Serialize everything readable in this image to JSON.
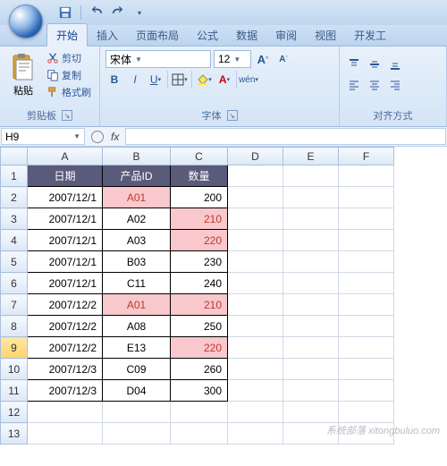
{
  "qat": {
    "save": "save",
    "undo": "undo",
    "redo": "redo"
  },
  "tabs": {
    "home": "开始",
    "insert": "插入",
    "layout": "页面布局",
    "formulas": "公式",
    "data": "数据",
    "review": "审阅",
    "view": "视图",
    "developer": "开发工"
  },
  "clipboard": {
    "paste": "粘贴",
    "cut": "剪切",
    "copy": "复制",
    "format_painter": "格式刷",
    "group": "剪贴板"
  },
  "font": {
    "name": "宋体",
    "size": "12",
    "grow": "A",
    "shrink": "A",
    "bold": "B",
    "italic": "I",
    "underline": "U",
    "group": "字体"
  },
  "align": {
    "group": "对齐方式"
  },
  "namebox": "H9",
  "fx": "fx",
  "columns": [
    "A",
    "B",
    "C",
    "D",
    "E",
    "F"
  ],
  "rows": [
    "1",
    "2",
    "3",
    "4",
    "5",
    "6",
    "7",
    "8",
    "9",
    "10",
    "11",
    "12",
    "13"
  ],
  "selected_row": "9",
  "headers": {
    "date": "日期",
    "pid": "产品ID",
    "qty": "数量"
  },
  "data": [
    {
      "date": "2007/12/1",
      "pid": "A01",
      "qty": "200",
      "pid_hl": true,
      "qty_hl": false
    },
    {
      "date": "2007/12/1",
      "pid": "A02",
      "qty": "210",
      "pid_hl": false,
      "qty_hl": true
    },
    {
      "date": "2007/12/1",
      "pid": "A03",
      "qty": "220",
      "pid_hl": false,
      "qty_hl": true
    },
    {
      "date": "2007/12/1",
      "pid": "B03",
      "qty": "230",
      "pid_hl": false,
      "qty_hl": false
    },
    {
      "date": "2007/12/1",
      "pid": "C11",
      "qty": "240",
      "pid_hl": false,
      "qty_hl": false
    },
    {
      "date": "2007/12/2",
      "pid": "A01",
      "qty": "210",
      "pid_hl": true,
      "qty_hl": true
    },
    {
      "date": "2007/12/2",
      "pid": "A08",
      "qty": "250",
      "pid_hl": false,
      "qty_hl": false
    },
    {
      "date": "2007/12/2",
      "pid": "E13",
      "qty": "220",
      "pid_hl": false,
      "qty_hl": true
    },
    {
      "date": "2007/12/3",
      "pid": "C09",
      "qty": "260",
      "pid_hl": false,
      "qty_hl": false
    },
    {
      "date": "2007/12/3",
      "pid": "D04",
      "qty": "300",
      "pid_hl": false,
      "qty_hl": false
    }
  ],
  "watermark": "系统部落 xitongbuluo.com"
}
